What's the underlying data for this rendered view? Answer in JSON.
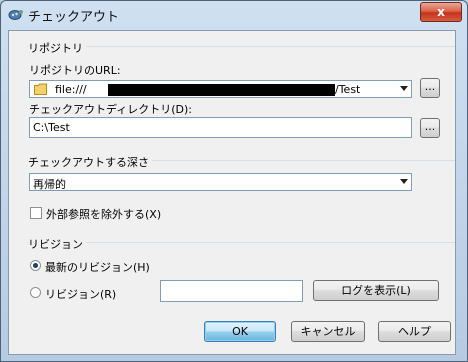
{
  "window": {
    "title": "チェックアウト",
    "close_label": "x"
  },
  "repository": {
    "group_label": "リポジトリ",
    "url_label": "リポジトリのURL:",
    "url_prefix": "file:///",
    "url_suffix": "/Test",
    "dir_label": "チェックアウトディレクトリ(D):",
    "dir_value": "C:\\Test",
    "browse_label": "..."
  },
  "depth": {
    "group_label": "チェックアウトする深さ",
    "value": "再帰的",
    "omit_externals_label": "外部参照を除外する(X)",
    "omit_externals_checked": false
  },
  "revision": {
    "group_label": "リビジョン",
    "head_label": "最新のリビジョン(H)",
    "head_selected": true,
    "rev_label": "リビジョン(R)",
    "rev_value": "",
    "show_log_label": "ログを表示(L)"
  },
  "buttons": {
    "ok": "OK",
    "cancel": "キャンセル",
    "help": "ヘルプ"
  }
}
